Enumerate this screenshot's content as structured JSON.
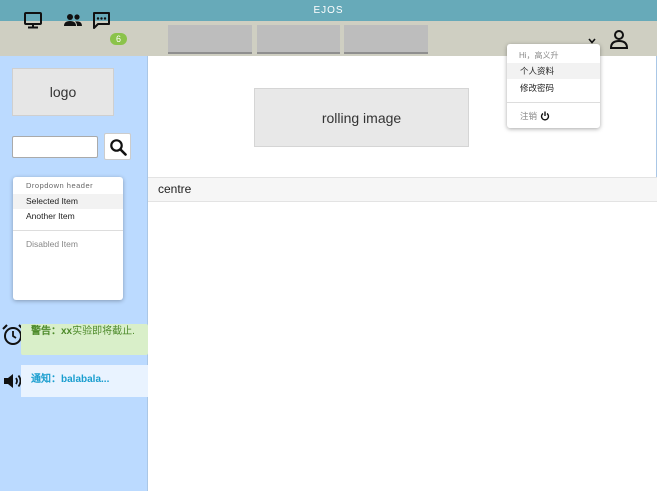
{
  "window": {
    "title": "EJOS"
  },
  "topbar": {
    "icons": [
      "monitor-icon",
      "people-icon",
      "chat-icon"
    ],
    "chat_badge": "6",
    "tabs": [
      "",
      "",
      ""
    ],
    "user_icon": "person-icon"
  },
  "user_menu": {
    "greeting": "Hi，高义升",
    "items": [
      "个人资料",
      "修改密码"
    ],
    "logout_label": "注销"
  },
  "sidebar": {
    "logo_label": "logo",
    "search": {
      "value": "",
      "placeholder": ""
    },
    "dropdown": {
      "header": "Dropdown header",
      "selected_item": "Selected Item",
      "another_item": "Another Item",
      "disabled_item": "Disabled Item"
    },
    "warning": {
      "label": "警告：xx",
      "text": "实验即将截止."
    },
    "notice": {
      "text": "通知：balabala..."
    }
  },
  "main": {
    "rolling_image_label": "rolling image",
    "section_title": "centre"
  },
  "colors": {
    "titlebar": "#67aab9",
    "topbar": "#cfcfc2",
    "sidebar": "#bbdaff",
    "badge": "#8bc34a",
    "warning_bg": "#d9efc9",
    "warning_text": "#4d8a2a",
    "notice_bg": "#e9f3ff",
    "notice_text": "#1a9ecf"
  }
}
